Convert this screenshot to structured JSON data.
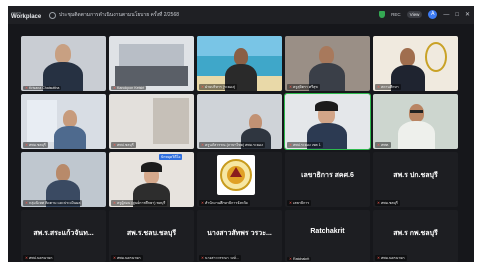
{
  "titlebar": {
    "brand_small": "zoom",
    "brand": "Workplace",
    "meeting_title": "ประชุมติดตามการดำเนินงานตามนโยบาย ครั้งที่ 2/2568",
    "rec_label": "REC",
    "view_label": "View",
    "window_buttons": [
      "—",
      "□",
      "✕"
    ]
  },
  "colors": {
    "background": "#16171b",
    "titlebar": "#1f2024",
    "mic_off": "#ff5a4f",
    "speaking_border": "#2db84d",
    "accent": "#3d7bf2"
  },
  "participants": [
    {
      "name": "Krisana Chaisuttha",
      "muted": true
    },
    {
      "name": "Kanokpon Ketsiri",
      "muted": true
    },
    {
      "name": "ฝ่ายบริหาร (ระยอง)",
      "muted": true
    },
    {
      "name": "ครูสุจิตรา ศรีสุข",
      "muted": true
    },
    {
      "name": "สถานศึกษา",
      "muted": true
    },
    {
      "name": "สพม.ชลบุรี",
      "muted": true
    },
    {
      "name": "สพป.ชลบุรี",
      "muted": true
    },
    {
      "name": "ครูนภัสวรรณ (ภาษาไทย) สพม.ระยอง",
      "muted": true
    },
    {
      "name": "สพป.ระยอง เขต 1",
      "muted": true
    },
    {
      "name": "สพท.",
      "muted": true
    },
    {
      "name": "กลุ่มนิเทศ ติดตาม และประเมินผล",
      "muted": true
    },
    {
      "name": "ครูผู้สอน (ศูนย์การศึกษา) ชลบุรี",
      "muted": true,
      "chip": "ปักหมุดวิดีโอ"
    },
    {
      "name": "สำนักงานศึกษาธิการจังหวัด",
      "muted": true
    },
    {
      "name": "เลขาธิการ",
      "muted": true,
      "display": "เลขาธิการ สคศ.6"
    },
    {
      "name": "สพม.ชลบุรี",
      "muted": true,
      "display": "สพ.ร ปก.ชลบุรี"
    },
    {
      "name": "สพป.นครนายก",
      "muted": true,
      "display": "สพ.ร.สระแก้วจันท..."
    },
    {
      "name": "สพม.นครนายก",
      "muted": true,
      "display": "สพ.ร.ชลบ.ชลบุรี"
    },
    {
      "name": "นางสาววรรณา วงษ์...",
      "muted": true,
      "display": "นางสาวสัทพร วรวะ..."
    },
    {
      "name": "Ratchakrit",
      "muted": true,
      "display": "Ratchakrit"
    },
    {
      "name": "สพม.นครนายก",
      "muted": true,
      "display": "สพ.ร กพ.ชลบุรี"
    }
  ]
}
